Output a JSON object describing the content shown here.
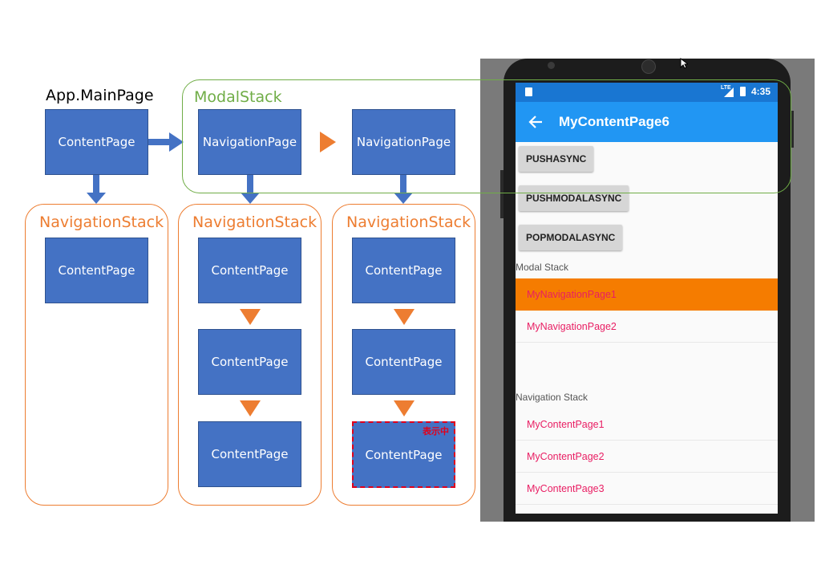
{
  "diagram": {
    "app_main_page": "App.MainPage",
    "modal_stack_label": "ModalStack",
    "navigation_stack_label": "NavigationStack",
    "content_page": "ContentPage",
    "navigation_page": "NavigationPage",
    "showing_badge": "表示中",
    "colors": {
      "box": "#4472c4",
      "nav_stack": "#ed7d31",
      "modal_stack": "#70ad47",
      "showing": "#e0001b"
    }
  },
  "phone": {
    "status_time": "4:35",
    "status_network": "LTE",
    "title": "MyContentPage6",
    "back_icon": "arrow-left-icon",
    "buttons": [
      "PUSHASYNC",
      "PUSHMODALASYNC",
      "POPMODALASYNC"
    ],
    "modal_stack_label": "Modal Stack",
    "modal_items": [
      {
        "label": "MyNavigationPage1",
        "selected": true
      },
      {
        "label": "MyNavigationPage2",
        "selected": false
      }
    ],
    "navigation_stack_label": "Navigation Stack",
    "navigation_items": [
      "MyContentPage1",
      "MyContentPage2",
      "MyContentPage3"
    ],
    "colors": {
      "appbar": "#2196f3",
      "statusbar": "#1976d2",
      "selected": "#f57c00",
      "item_text": "#e91e63"
    }
  }
}
